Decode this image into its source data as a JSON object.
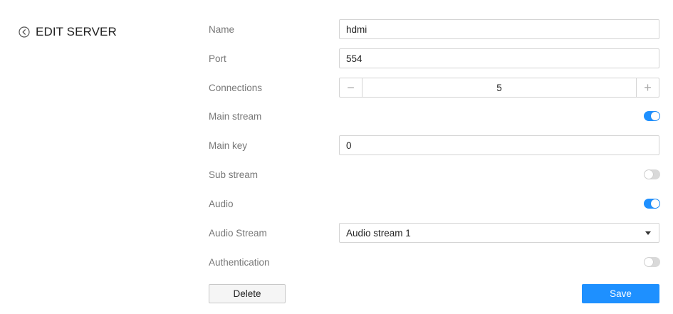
{
  "header": {
    "title": "EDIT SERVER",
    "back_icon": "back-circle-icon"
  },
  "form": {
    "name": {
      "label": "Name",
      "value": "hdmi"
    },
    "port": {
      "label": "Port",
      "value": "554"
    },
    "connections": {
      "label": "Connections",
      "value": "5",
      "minus_glyph": "−",
      "plus_glyph": "+"
    },
    "main_stream": {
      "label": "Main stream",
      "enabled": true
    },
    "main_key": {
      "label": "Main key",
      "value": "0"
    },
    "sub_stream": {
      "label": "Sub stream",
      "enabled": false
    },
    "audio": {
      "label": "Audio",
      "enabled": true
    },
    "audio_stream": {
      "label": "Audio Stream",
      "value": "Audio stream 1"
    },
    "authentication": {
      "label": "Authentication",
      "enabled": false
    }
  },
  "actions": {
    "delete_label": "Delete",
    "save_label": "Save"
  },
  "colors": {
    "accent": "#1e90ff",
    "toggle_off": "#d9d9d9",
    "label_text": "#777777",
    "border": "#d4d4d4"
  }
}
